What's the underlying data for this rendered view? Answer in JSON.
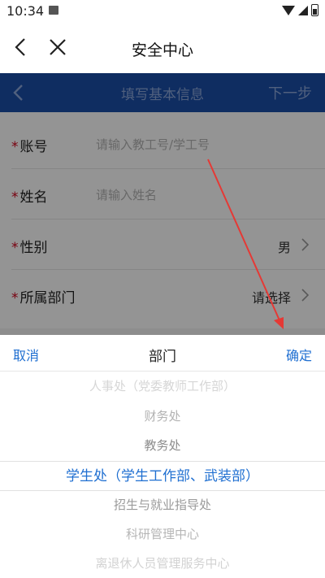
{
  "status": {
    "time": "10:34"
  },
  "top_nav": {
    "title": "安全中心"
  },
  "header": {
    "title": "填写基本信息",
    "next": "下一步"
  },
  "form": {
    "account": {
      "label": "账号",
      "placeholder": "请输入教工号/学工号"
    },
    "name": {
      "label": "姓名",
      "placeholder": "请输入姓名"
    },
    "gender": {
      "label": "性别",
      "value": "男"
    },
    "department": {
      "label": "所属部门",
      "value": "请选择"
    },
    "required_mark": "*"
  },
  "picker": {
    "cancel": "取消",
    "title": "部门",
    "confirm": "确定",
    "items": [
      "人事处（党委教师工作部）",
      "财务处",
      "教务处",
      "学生处（学生工作部、武装部）",
      "招生与就业指导处",
      "科研管理中心",
      "离退休人员管理服务中心"
    ],
    "selected_index": 3
  },
  "colors": {
    "header_blue": "#1b4ea8",
    "accent_blue": "#1f6fd1",
    "required_red": "#d0021b",
    "annotation_arrow": "#e53935"
  }
}
